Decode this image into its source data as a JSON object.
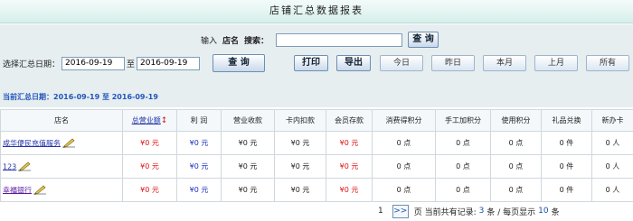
{
  "title": "店铺汇总数据报表",
  "search": {
    "input_label": "输入",
    "store_label": "店名",
    "search_label": "搜索：",
    "value": "",
    "query_button": "查 询"
  },
  "date_filter": {
    "label": "选择汇总日期：",
    "start": "2016-09-19",
    "to": "至",
    "end": "2016-09-19",
    "query_button": "查 询",
    "print_button": "打印",
    "export_button": "导出",
    "quick": [
      "今日",
      "昨日",
      "本月",
      "上月",
      "所有"
    ]
  },
  "current_range": "当前汇总日期：2016-09-19 至 2016-09-19",
  "table": {
    "headers": {
      "store": "店名",
      "revenue": "总营业额",
      "profit": "利 润",
      "income": "营业收款",
      "card_deduct": "卡内扣款",
      "member_deposit": "会员存款",
      "consume_points": "消费得积分",
      "manual_points": "手工加积分",
      "used_points": "使用积分",
      "gift": "礼品兑换",
      "new_card": "新办卡"
    },
    "rows": [
      {
        "store": "成华便民充值服务",
        "revenue": "¥0 元",
        "profit": "¥0 元",
        "income": "¥0 元",
        "card_deduct": "¥0 元",
        "member_deposit": "¥0 元",
        "consume_points": "0 点",
        "manual_points": "0 点",
        "used_points": "0 点",
        "gift": "0 件",
        "new_card": "0 人"
      },
      {
        "store": "123",
        "revenue": "¥0 元",
        "profit": "¥0 元",
        "income": "¥0 元",
        "card_deduct": "¥0 元",
        "member_deposit": "¥0 元",
        "consume_points": "0 点",
        "manual_points": "0 点",
        "used_points": "0 点",
        "gift": "0 件",
        "new_card": "0 人"
      },
      {
        "store": "幸福银行",
        "revenue": "¥0 元",
        "profit": "¥0 元",
        "income": "¥0 元",
        "card_deduct": "¥0 元",
        "member_deposit": "¥0 元",
        "consume_points": "0 点",
        "manual_points": "0 点",
        "used_points": "0 点",
        "gift": "0 件",
        "new_card": "0 人"
      }
    ]
  },
  "pager": {
    "page": "1",
    "next": ">>",
    "current_page_label": "页 当前共有记录:",
    "total": "3",
    "per_page_label": "条 / 每页显示",
    "page_size": "10",
    "unit": "条"
  }
}
